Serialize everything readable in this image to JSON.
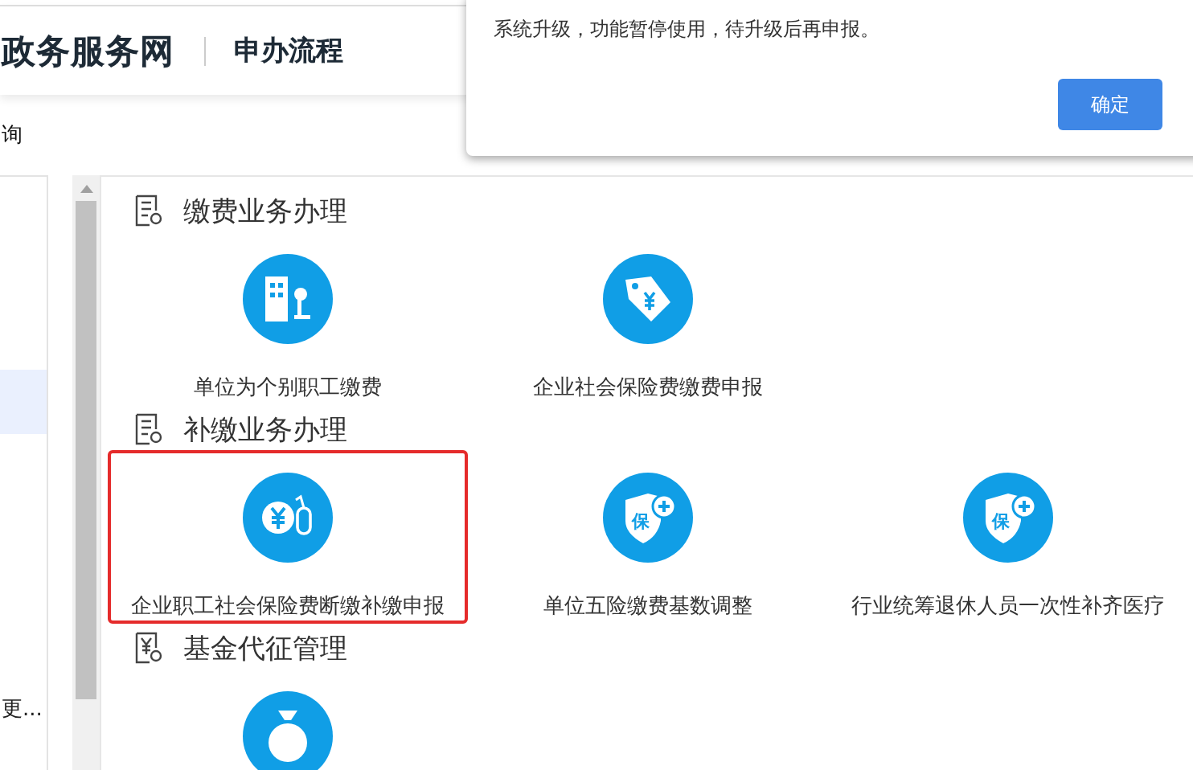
{
  "header": {
    "site_title": "政务服务网",
    "page_title": "申办流程"
  },
  "nav_tab": "询",
  "sidebar": {
    "items": [
      {
        "selected": true
      },
      {
        "label": "更...",
        "selected": false
      }
    ]
  },
  "sections": [
    {
      "title": "缴费业务办理",
      "kind": "doc",
      "items": [
        {
          "label": "单位为个别职工缴费",
          "kind": "building",
          "highlighted": false
        },
        {
          "label": "企业社会保险费缴费申报",
          "kind": "tag",
          "highlighted": false
        }
      ]
    },
    {
      "title": "补缴业务办理",
      "kind": "doc",
      "items": [
        {
          "label": "企业职工社会保险费断缴补缴申报",
          "kind": "coin",
          "highlighted": true
        },
        {
          "label": "单位五险缴费基数调整",
          "kind": "shield",
          "badge": "保",
          "highlighted": false
        },
        {
          "label": "行业统筹退休人员一次性补齐医疗",
          "kind": "shield",
          "badge": "保",
          "highlighted": false
        }
      ]
    },
    {
      "title": "基金代征管理",
      "kind": "yen",
      "items": [
        {
          "kind": "bag",
          "highlighted": false
        }
      ]
    }
  ],
  "dialog": {
    "message": "系统升级，功能暂停使用，待升级后再申报。",
    "button": "确定"
  }
}
